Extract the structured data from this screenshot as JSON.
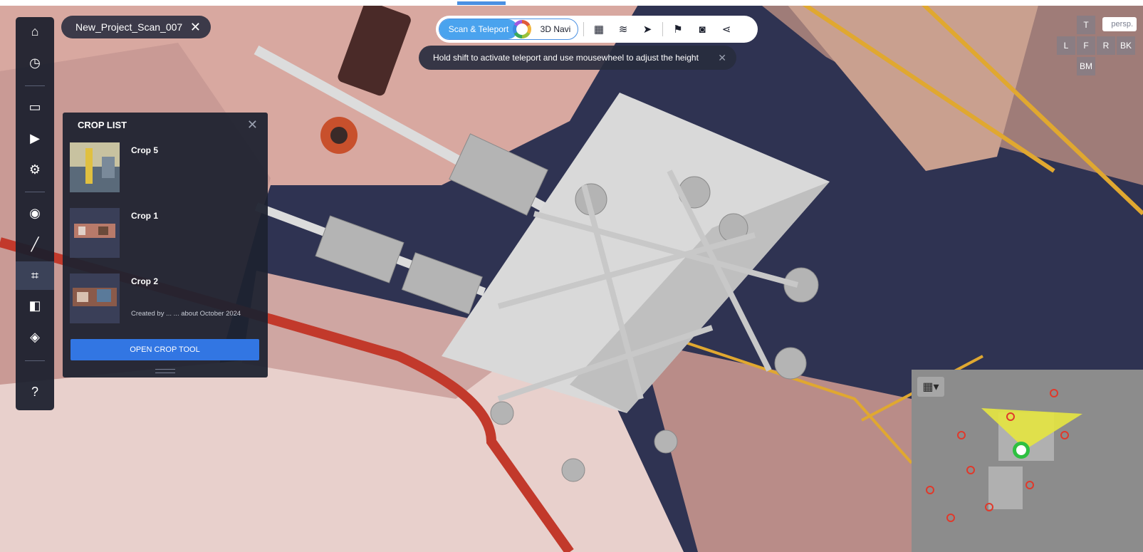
{
  "file_tab": {
    "name": "New_Project_Scan_007",
    "close": "✕"
  },
  "sidebar": {
    "items": [
      {
        "icon": "home-icon",
        "glyph": "⌂"
      },
      {
        "icon": "clock-icon",
        "glyph": "◷"
      },
      {
        "icon": "monitor-icon",
        "glyph": "▭"
      },
      {
        "icon": "video-camera-icon",
        "glyph": "▶"
      },
      {
        "icon": "gear-icon",
        "glyph": "⚙"
      },
      {
        "icon": "location-pin-icon",
        "glyph": "◉"
      },
      {
        "icon": "ruler-icon",
        "glyph": "╱"
      },
      {
        "icon": "crop-icon",
        "glyph": "⌗"
      },
      {
        "icon": "compare-icon",
        "glyph": "◧"
      },
      {
        "icon": "layers-icon",
        "glyph": "◈"
      },
      {
        "icon": "help-icon",
        "glyph": "?"
      }
    ],
    "active_item": "crop-icon"
  },
  "crop_list": {
    "title": "CROP LIST",
    "close": "✕",
    "items": [
      {
        "name": "Crop 5",
        "meta": ""
      },
      {
        "name": "Crop 1",
        "meta": ""
      },
      {
        "name": "Crop 2",
        "meta": "Created by ... ... about October 2024"
      }
    ],
    "open_button": "OPEN CROP TOOL"
  },
  "toolbar": {
    "scan_teleport": "Scan & Teleport",
    "navi_3d": "3D Navi",
    "tools": [
      "grid-icon",
      "layers-icon",
      "pointer-icon",
      "flag-icon",
      "camera-icon",
      "share-icon"
    ],
    "tool_glyphs": [
      "▦",
      "≋",
      "➤",
      "⚑",
      "◙",
      "⋖"
    ]
  },
  "hint": {
    "text": "Hold shift to activate teleport and use mousewheel to adjust the height",
    "close": "✕"
  },
  "view_cube": {
    "top": "T",
    "left": "L",
    "front": "F",
    "right": "R",
    "back": "BK",
    "bottom": "BM",
    "persp": "persp."
  },
  "minimap": {
    "grid_button": "▦▾"
  }
}
